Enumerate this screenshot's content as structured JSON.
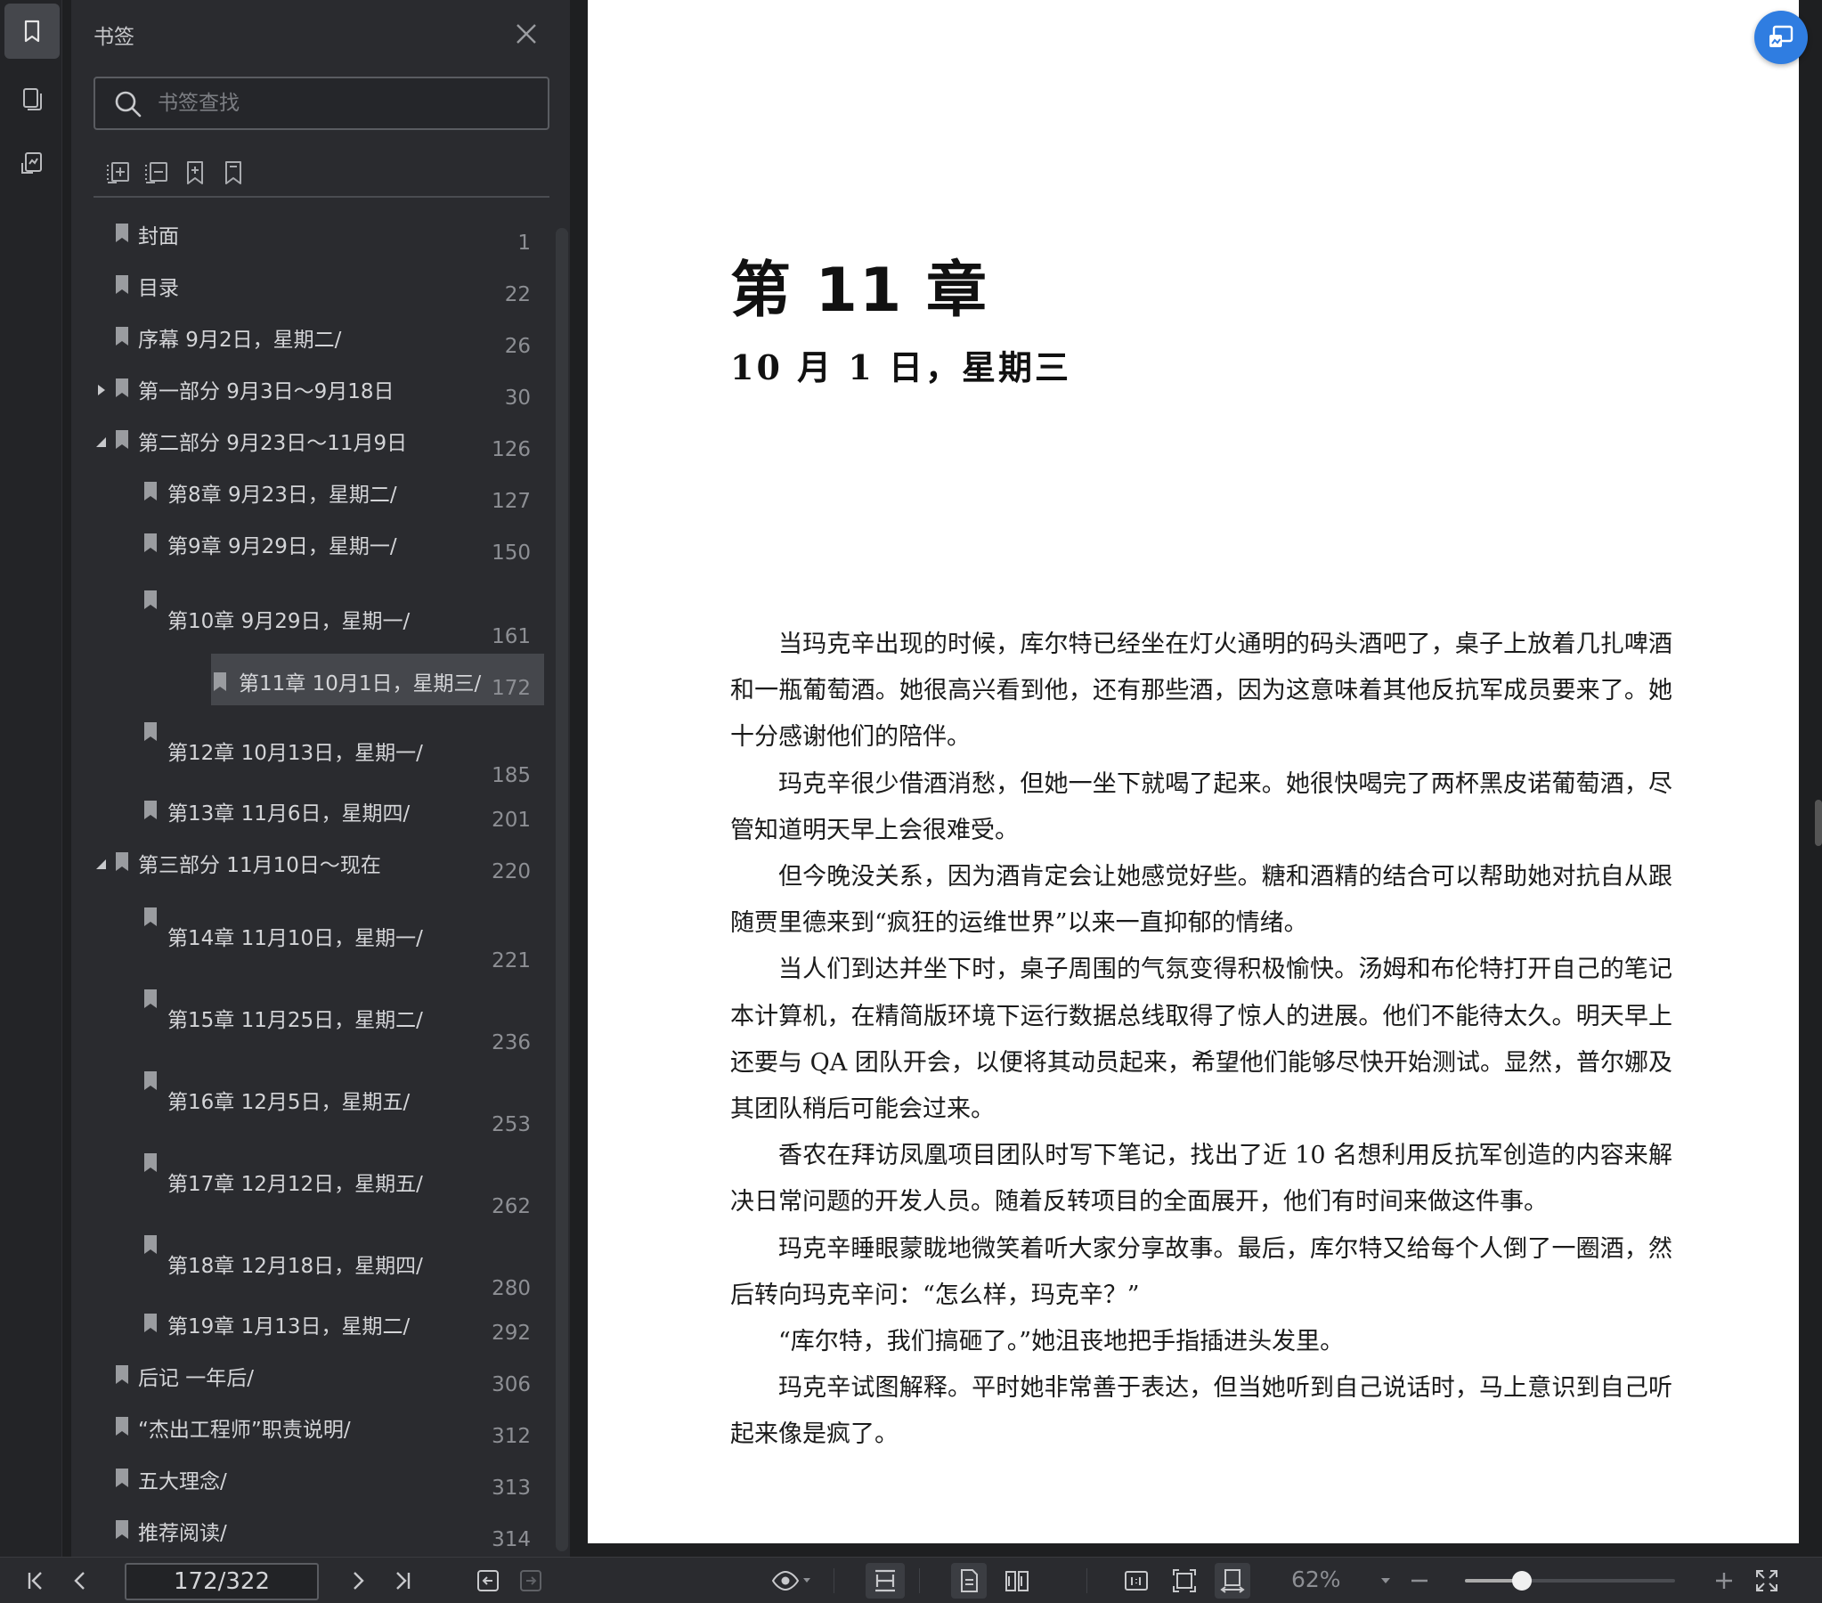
{
  "sidebar": {
    "title": "书签",
    "search_placeholder": "书签查找",
    "items": [
      {
        "label": "封面",
        "page": "1"
      },
      {
        "label": "目录",
        "page": "22"
      },
      {
        "label": "序幕 9月2日，星期二/",
        "page": "26"
      },
      {
        "label": "第一部分 9月3日～9月18日",
        "page": "30",
        "expander": "collapsed"
      },
      {
        "label": "第二部分 9月23日～11月9日",
        "page": "126",
        "expander": "expanded"
      },
      {
        "label": "第8章 9月23日，星期二/",
        "page": "127"
      },
      {
        "label": "第9章 9月29日，星期一/",
        "page": "150"
      },
      {
        "label": "第10章 9月29日，星期一/",
        "page": "161"
      },
      {
        "label": "第11章 10月1日，星期三/",
        "page": "172",
        "selected": true
      },
      {
        "label": "第12章 10月13日，星期一/",
        "page": "185"
      },
      {
        "label": "第13章 11月6日，星期四/",
        "page": "201"
      },
      {
        "label": "第三部分 11月10日～现在",
        "page": "220",
        "expander": "expanded"
      },
      {
        "label": "第14章 11月10日，星期一/",
        "page": "221"
      },
      {
        "label": "第15章 11月25日，星期二/",
        "page": "236"
      },
      {
        "label": "第16章 12月5日，星期五/",
        "page": "253"
      },
      {
        "label": "第17章 12月12日，星期五/",
        "page": "262"
      },
      {
        "label": "第18章 12月18日，星期四/",
        "page": "280"
      },
      {
        "label": "第19章 1月13日，星期二/",
        "page": "292"
      },
      {
        "label": "后记 一年后/",
        "page": "306"
      },
      {
        "label": "“杰出工程师”职责说明/",
        "page": "312"
      },
      {
        "label": "五大理念/",
        "page": "313"
      },
      {
        "label": "推荐阅读/",
        "page": "314"
      }
    ]
  },
  "document": {
    "chapter_title": "第 11 章",
    "subtitle": "10 月 1 日，星期三",
    "paragraphs": [
      "当玛克辛出现的时候，库尔特已经坐在灯火通明的码头酒吧了，桌子上放着几扎啤酒和一瓶葡萄酒。她很高兴看到他，还有那些酒，因为这意味着其他反抗军成员要来了。她十分感谢他们的陪伴。",
      "玛克辛很少借酒消愁，但她一坐下就喝了起来。她很快喝完了两杯黑皮诺葡萄酒，尽管知道明天早上会很难受。",
      "但今晚没关系，因为酒肯定会让她感觉好些。糖和酒精的结合可以帮助她对抗自从跟随贾里德来到“疯狂的运维世界”以来一直抑郁的情绪。",
      "当人们到达并坐下时，桌子周围的气氛变得积极愉快。汤姆和布伦特打开自己的笔记本计算机，在精简版环境下运行数据总线取得了惊人的进展。他们不能待太久。明天早上还要与 QA 团队开会，以便将其动员起来，希望他们能够尽快开始测试。显然，普尔娜及其团队稍后可能会过来。",
      "香农在拜访凤凰项目团队时写下笔记，找出了近 10 名想利用反抗军创造的内容来解决日常问题的开发人员。随着反转项目的全面展开，他们有时间来做这件事。",
      "玛克辛睡眼蒙眬地微笑着听大家分享故事。最后，库尔特又给每个人倒了一圈酒，然后转向玛克辛问：“怎么样，玛克辛？”",
      "“库尔特，我们搞砸了。”她沮丧地把手指插进头发里。",
      "玛克辛试图解释。平时她非常善于表达，但当她听到自己说话时，马上意识到自己听起来像是疯了。"
    ]
  },
  "bottombar": {
    "page_indicator": "172/322",
    "zoom_label": "62%",
    "zoom_slider_fraction": 0.27
  }
}
